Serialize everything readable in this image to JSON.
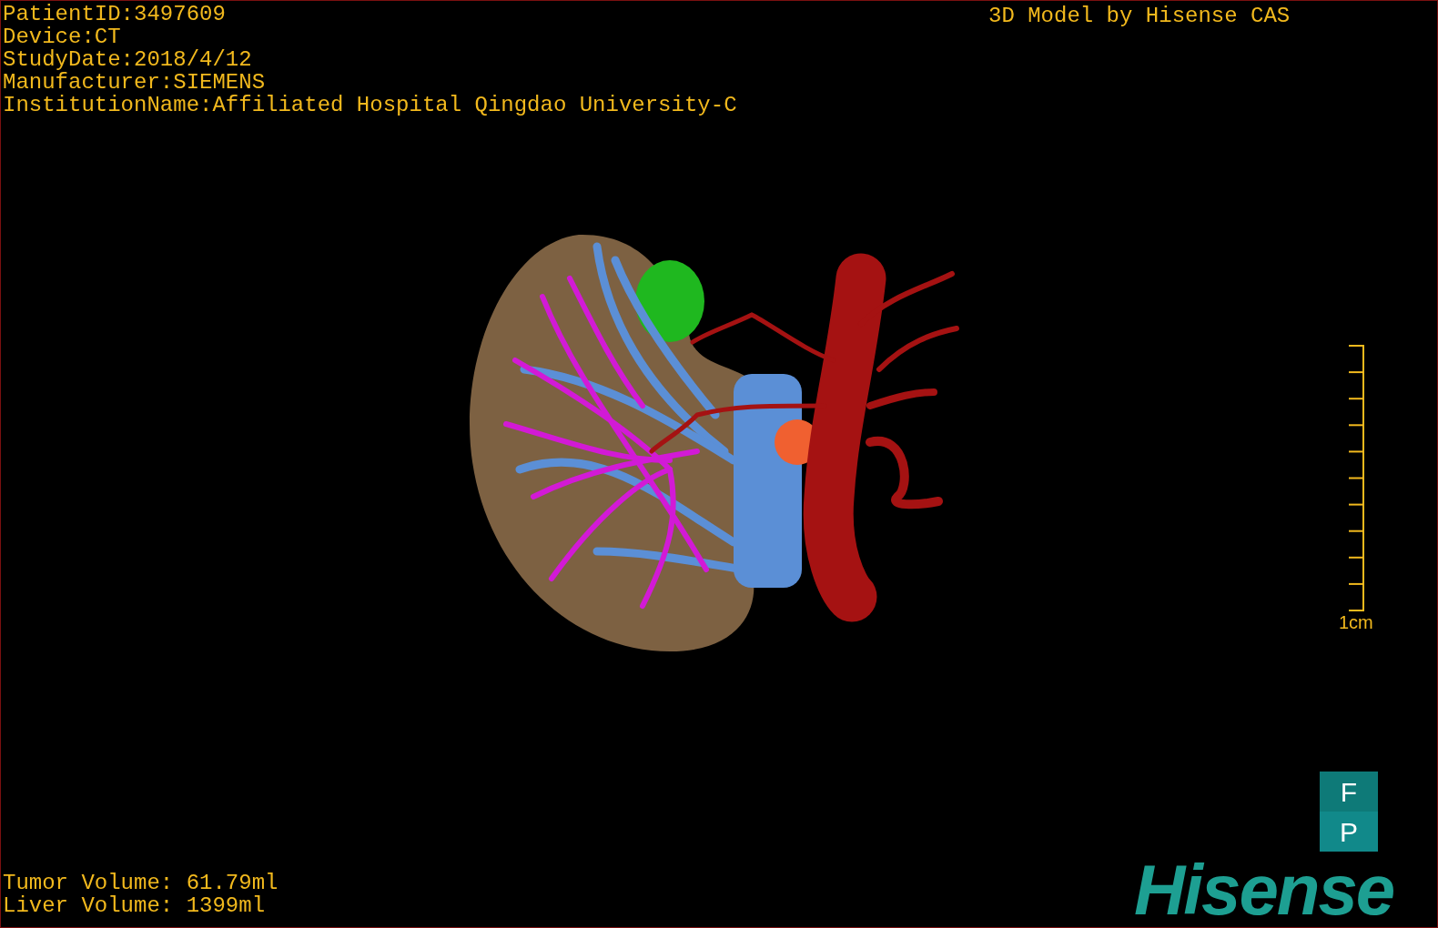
{
  "viewer": {
    "patient_info": [
      "PatientID:3497609",
      "Device:CT",
      "StudyDate:2018/4/12",
      "Manufacturer:SIEMENS",
      "InstitutionName:Affiliated Hospital Qingdao University-C"
    ],
    "caption": "3D Model by Hisense CAS",
    "scale_bar": {
      "label": "1cm"
    },
    "volumes": [
      "Tumor Volume: 61.79ml",
      "Liver Volume: 1399ml"
    ],
    "orientation_marker": [
      "F",
      "P"
    ],
    "logo": "Hisense"
  }
}
